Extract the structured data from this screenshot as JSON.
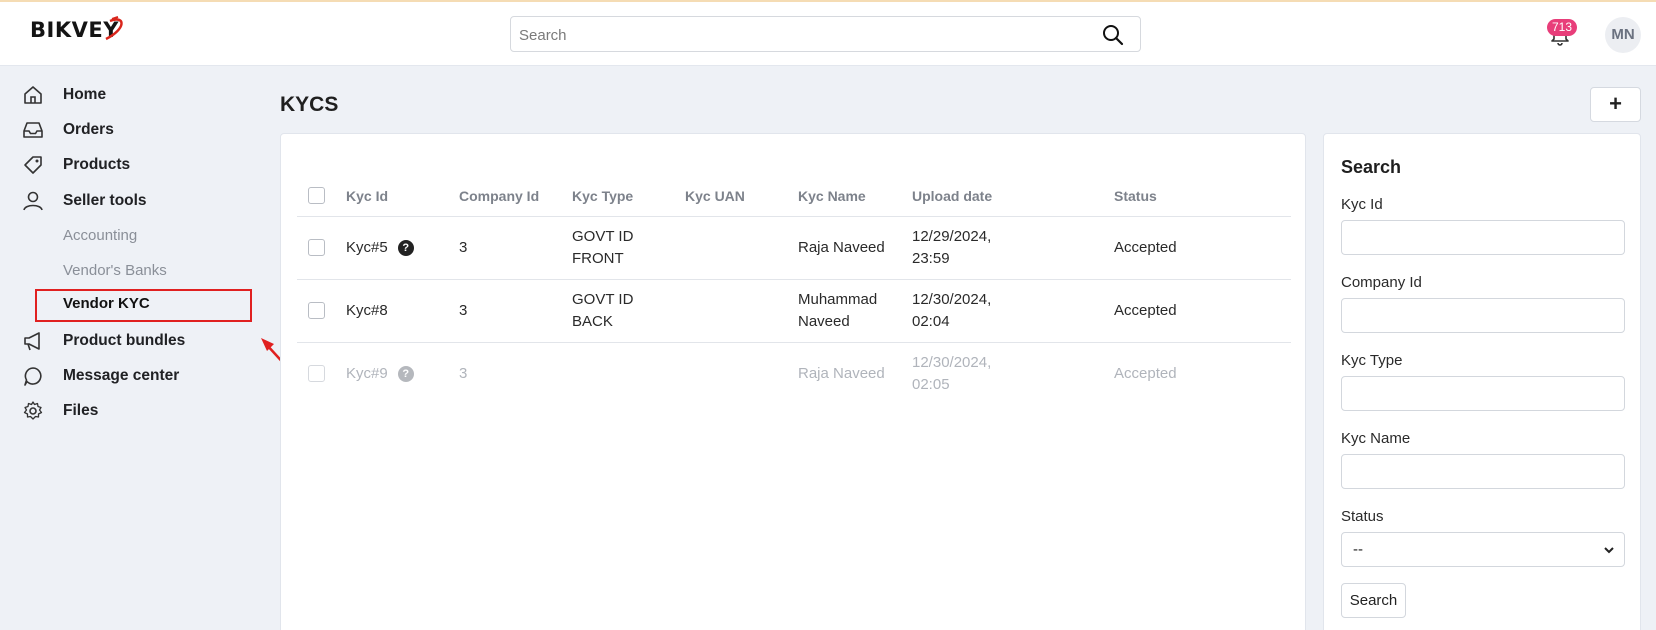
{
  "brand": {
    "logo_text": "BIKVEY"
  },
  "header": {
    "search_placeholder": "Search",
    "notification_count": "713",
    "avatar_initials": "MN"
  },
  "sidebar": {
    "items": [
      {
        "label": "Home",
        "icon": "home-icon"
      },
      {
        "label": "Orders",
        "icon": "inbox-icon"
      },
      {
        "label": "Products",
        "icon": "tag-icon"
      },
      {
        "label": "Seller tools",
        "icon": "user-icon"
      }
    ],
    "sub_items": [
      {
        "label": "Accounting"
      },
      {
        "label": "Vendor's Banks"
      },
      {
        "label": "Vendor KYC",
        "active": true
      }
    ],
    "items_after": [
      {
        "label": "Product bundles",
        "icon": "megaphone-icon"
      },
      {
        "label": "Message center",
        "icon": "chat-icon"
      },
      {
        "label": "Files",
        "icon": "gear-icon"
      }
    ]
  },
  "page": {
    "title": "KYCS",
    "add_label": "+"
  },
  "table": {
    "columns": [
      "Kyc Id",
      "Company Id",
      "Kyc Type",
      "Kyc UAN",
      "Kyc Name",
      "Upload date",
      "Status"
    ],
    "rows": [
      {
        "kyc_id": "Kyc#5",
        "company_id": "3",
        "type_line1": "GOVT ID",
        "type_line2": "FRONT",
        "uan": "",
        "name_line1": "Raja Naveed",
        "name_line2": "",
        "date_line1": "12/29/2024,",
        "date_line2": "23:59",
        "status": "Accepted"
      },
      {
        "kyc_id": "Kyc#8",
        "company_id": "3",
        "type_line1": "GOVT ID",
        "type_line2": "BACK",
        "uan": "",
        "name_line1": "Muhammad",
        "name_line2": "Naveed",
        "date_line1": "12/30/2024,",
        "date_line2": "02:04",
        "status": "Accepted"
      },
      {
        "kyc_id": "Kyc#9",
        "company_id": "3",
        "type_line1": "",
        "type_line2": "",
        "uan": "",
        "name_line1": "Raja Naveed",
        "name_line2": "",
        "date_line1": "12/30/2024,",
        "date_line2": "02:05",
        "status": "Accepted"
      }
    ]
  },
  "filter": {
    "title": "Search",
    "fields": [
      "Kyc Id",
      "Company Id",
      "Kyc Type",
      "Kyc Name"
    ],
    "status_label": "Status",
    "status_value": "--",
    "button_label": "Search"
  },
  "colors": {
    "badge": "#e83e7a",
    "highlight": "#e02020",
    "sidebar_bg": "#eef1f6"
  }
}
